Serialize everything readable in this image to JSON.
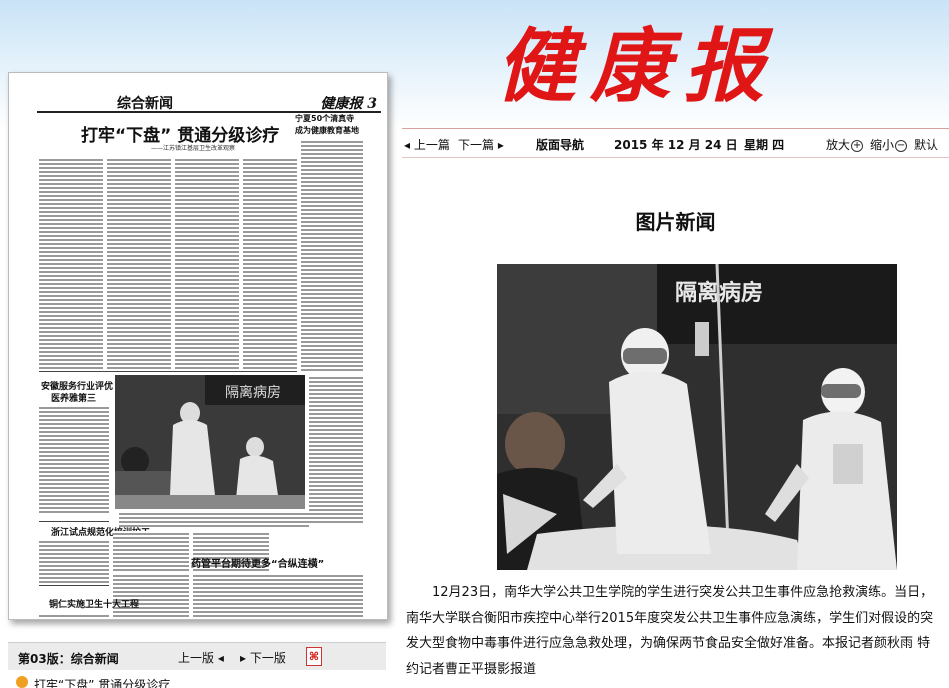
{
  "masthead": {
    "title": "健康报"
  },
  "thumbnail": {
    "section": "综合新闻",
    "paper_name": "健康报",
    "page_number": "3",
    "main_headline": "打牢“下盘” 贯通分级诊疗",
    "sub_headline": "——江苏镇江基层卫生改革观察",
    "right_headline_1": "宁夏50个清真寺",
    "right_headline_2": "成为健康教育基地",
    "head_anhui_1": "安徽服务行业评优",
    "head_anhui_2": "医养雅第三",
    "head_zhejiang": "浙江试点规范化培训护工",
    "head_drug": "药管平台期待更多“合纵连横”",
    "head_tongren": "铜仁实施卫生十大工程",
    "photo_sign": "隔离病房"
  },
  "nav": {
    "prev": "上一篇",
    "next": "下一篇",
    "page_nav": "版面导航",
    "date": "2015 年  12 月  24 日",
    "weekday": "星期 四",
    "zoom_in": "放大",
    "zoom_out": "缩小",
    "default": "默认"
  },
  "article": {
    "title": "图片新闻",
    "photo_sign": "隔离病房",
    "caption": "12月23日，南华大学公共卫生学院的学生进行突发公共卫生事件应急抢救演练。当日，南华大学联合衡阳市疾控中心举行2015年度突发公共卫生事件应急演练，学生们对假设的突发大型食物中毒事件进行应急急救处理，为确保两节食品安全做好准备。本报记者颜秋雨 特约记者曹正平摄影报道"
  },
  "edition_bar": {
    "label": "第03版：综合新闻",
    "prev_page": "上一版",
    "next_page": "下一版"
  },
  "article_list": [
    {
      "title": "打牢“下盘” 贯通分级诊疗"
    }
  ]
}
